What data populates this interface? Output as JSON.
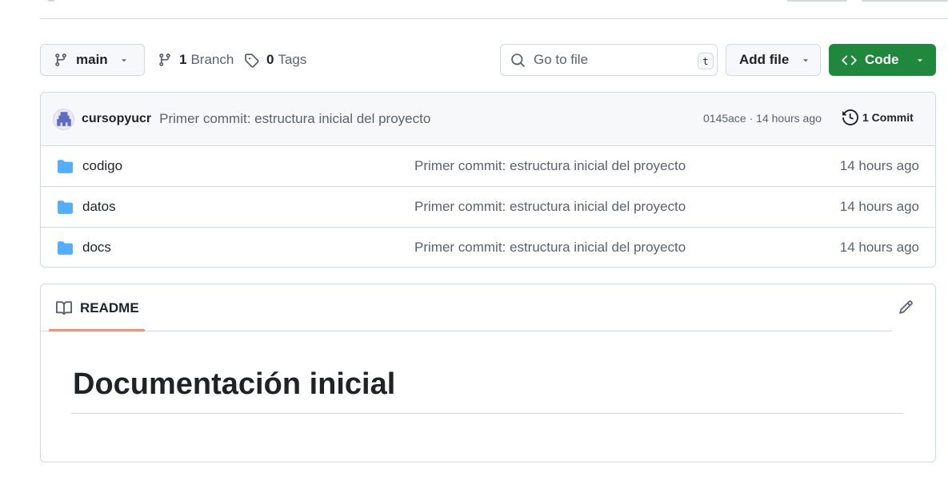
{
  "toolbar": {
    "branch_label": "main",
    "branches_count": "1",
    "branches_label": "Branch",
    "tags_count": "0",
    "tags_label": "Tags",
    "search_placeholder": "Go to file",
    "search_shortcut": "t",
    "add_file_label": "Add file",
    "code_label": "Code"
  },
  "commit": {
    "author": "cursopyucr",
    "message": "Primer commit: estructura inicial del proyecto",
    "meta": "0145ace · 14 hours ago",
    "count_label": "1 Commit"
  },
  "files": [
    {
      "name": "codigo",
      "message": "Primer commit: estructura inicial del proyecto",
      "age": "14 hours ago"
    },
    {
      "name": "datos",
      "message": "Primer commit: estructura inicial del proyecto",
      "age": "14 hours ago"
    },
    {
      "name": "docs",
      "message": "Primer commit: estructura inicial del proyecto",
      "age": "14 hours ago"
    }
  ],
  "readme": {
    "tab_label": "README",
    "heading": "Documentación inicial"
  },
  "colors": {
    "primary_button": "#1f883d",
    "folder_icon": "#54aeff",
    "tab_accent": "#fd8c73"
  }
}
